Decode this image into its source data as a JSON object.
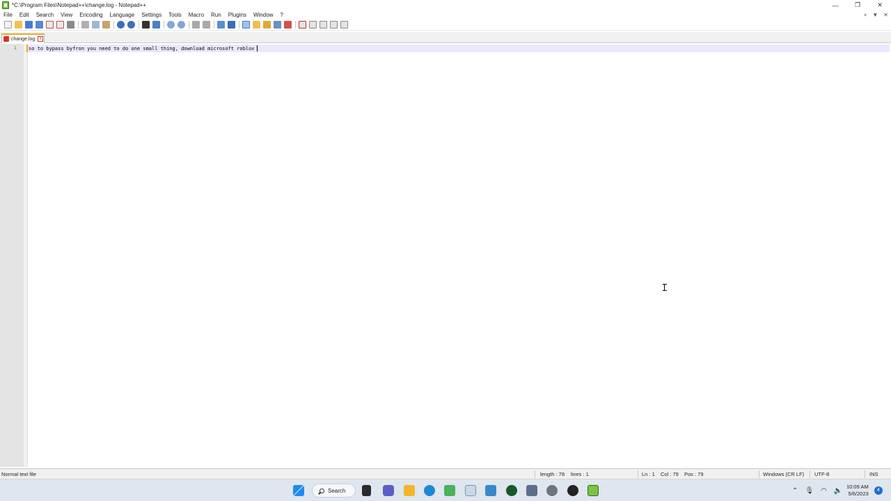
{
  "window": {
    "title": "*C:\\Program Files\\Notepad++\\change.log - Notepad++",
    "minimize_glyph": "—",
    "restore_glyph": "❐",
    "close_glyph": "✕"
  },
  "menu": {
    "items": [
      "File",
      "Edit",
      "Search",
      "View",
      "Encoding",
      "Language",
      "Settings",
      "Tools",
      "Macro",
      "Run",
      "Plugins",
      "Window",
      "?"
    ],
    "right": {
      "add": "+",
      "dropdown": "▼",
      "close": "✕"
    }
  },
  "toolbar": {
    "icons": [
      "new-file-icon",
      "open-file-icon",
      "save-icon",
      "save-all-icon",
      "close-icon",
      "close-all-icon",
      "print-icon",
      "cut-icon",
      "copy-icon",
      "paste-icon",
      "undo-icon",
      "redo-icon",
      "find-icon",
      "replace-icon",
      "zoom-in-icon",
      "zoom-out-icon",
      "sync-vertical-icon",
      "sync-horizontal-icon",
      "word-wrap-icon",
      "show-all-chars-icon",
      "indent-guide-icon",
      "document-map-icon",
      "function-list-icon",
      "folder-workspace-icon",
      "monitoring-icon",
      "record-macro-icon",
      "stop-record-icon",
      "playback-macro-icon",
      "run-macro-multiple-icon",
      "save-macro-icon"
    ]
  },
  "tabs": [
    {
      "label": "change.log",
      "close_glyph": "x"
    }
  ],
  "editor": {
    "lines": [
      {
        "number": "1",
        "text": "so to bypass byfron you need to do one small thing, download microsoft roblox"
      }
    ]
  },
  "status": {
    "file_type": "Normal text file",
    "length": "length : 78",
    "lines": "lines : 1",
    "ln": "Ln : 1",
    "col": "Col : 79",
    "pos": "Pos : 79",
    "eol": "Windows (CR LF)",
    "encoding": "UTF-8",
    "mode": "INS"
  },
  "taskbar": {
    "search_label": "Search",
    "clock_time": "10:09 AM",
    "clock_date": "5/6/2023",
    "notification_count": "4"
  },
  "colors": {
    "accent_tab": "#f5a623",
    "current_line": "#e8e8ff",
    "gutter": "#e4e4e4",
    "taskbar": "#dfe6ee"
  }
}
